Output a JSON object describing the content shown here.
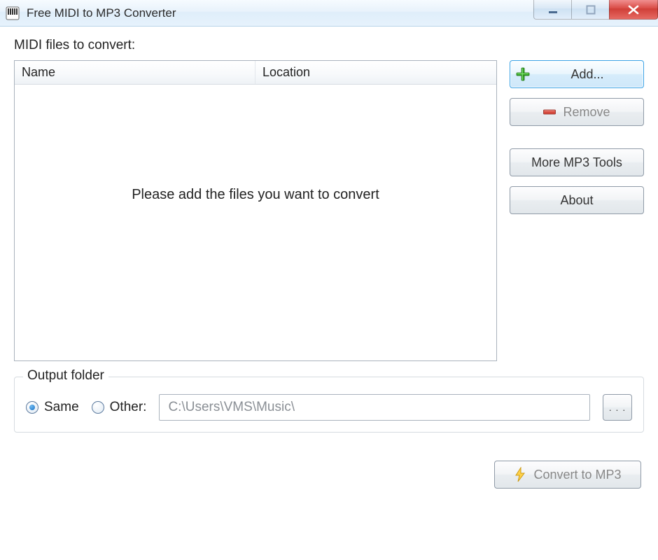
{
  "window": {
    "title": "Free MIDI to MP3 Converter"
  },
  "labels": {
    "files_to_convert": "MIDI files to convert:",
    "output_folder": "Output folder"
  },
  "filelist": {
    "columns": {
      "name": "Name",
      "location": "Location"
    },
    "placeholder": "Please add the files you want to convert"
  },
  "buttons": {
    "add": "Add...",
    "remove": "Remove",
    "more_tools": "More MP3 Tools",
    "about": "About",
    "browse": ". . .",
    "convert": "Convert to MP3"
  },
  "output": {
    "same_label": "Same",
    "other_label": "Other:",
    "selected": "same",
    "path": "C:\\Users\\VMS\\Music\\"
  }
}
